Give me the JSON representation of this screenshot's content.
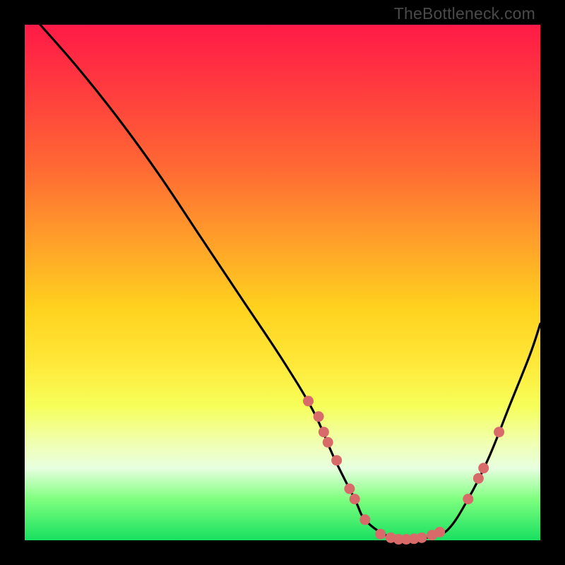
{
  "watermark": "TheBottleneck.com",
  "colors": {
    "curve": "#000000",
    "marker": "#d96a6a",
    "gradient_top": "#ff1a47",
    "gradient_mid": "#ffd21e",
    "gradient_bottom": "#18e060",
    "frame_bg": "#000000"
  },
  "chart_data": {
    "type": "line",
    "title": "",
    "xlabel": "",
    "ylabel": "",
    "xlim": [
      0,
      100
    ],
    "ylim": [
      0,
      100
    ],
    "grid": false,
    "series": [
      {
        "name": "bottleneck-curve",
        "x": [
          3,
          10,
          18,
          26,
          34,
          42,
          50,
          56,
          60,
          64,
          66,
          70,
          74,
          78,
          82,
          86,
          90,
          94,
          98,
          100
        ],
        "y": [
          100,
          92,
          82,
          71,
          59,
          47,
          35,
          25,
          16,
          8,
          4,
          1,
          0,
          0.5,
          2,
          8,
          16,
          26,
          36,
          42
        ]
      }
    ],
    "markers": [
      {
        "x": 55,
        "y": 27
      },
      {
        "x": 57,
        "y": 24
      },
      {
        "x": 58,
        "y": 21
      },
      {
        "x": 58.8,
        "y": 19
      },
      {
        "x": 60.5,
        "y": 15.5
      },
      {
        "x": 63,
        "y": 10
      },
      {
        "x": 64,
        "y": 8
      },
      {
        "x": 66,
        "y": 4
      },
      {
        "x": 69,
        "y": 1.2
      },
      {
        "x": 71,
        "y": 0.5
      },
      {
        "x": 72.5,
        "y": 0.2
      },
      {
        "x": 74,
        "y": 0.2
      },
      {
        "x": 75.5,
        "y": 0.3
      },
      {
        "x": 77,
        "y": 0.5
      },
      {
        "x": 79,
        "y": 1
      },
      {
        "x": 80.5,
        "y": 1.6
      },
      {
        "x": 86,
        "y": 8
      },
      {
        "x": 88,
        "y": 12
      },
      {
        "x": 89,
        "y": 14
      },
      {
        "x": 92,
        "y": 21
      }
    ]
  }
}
